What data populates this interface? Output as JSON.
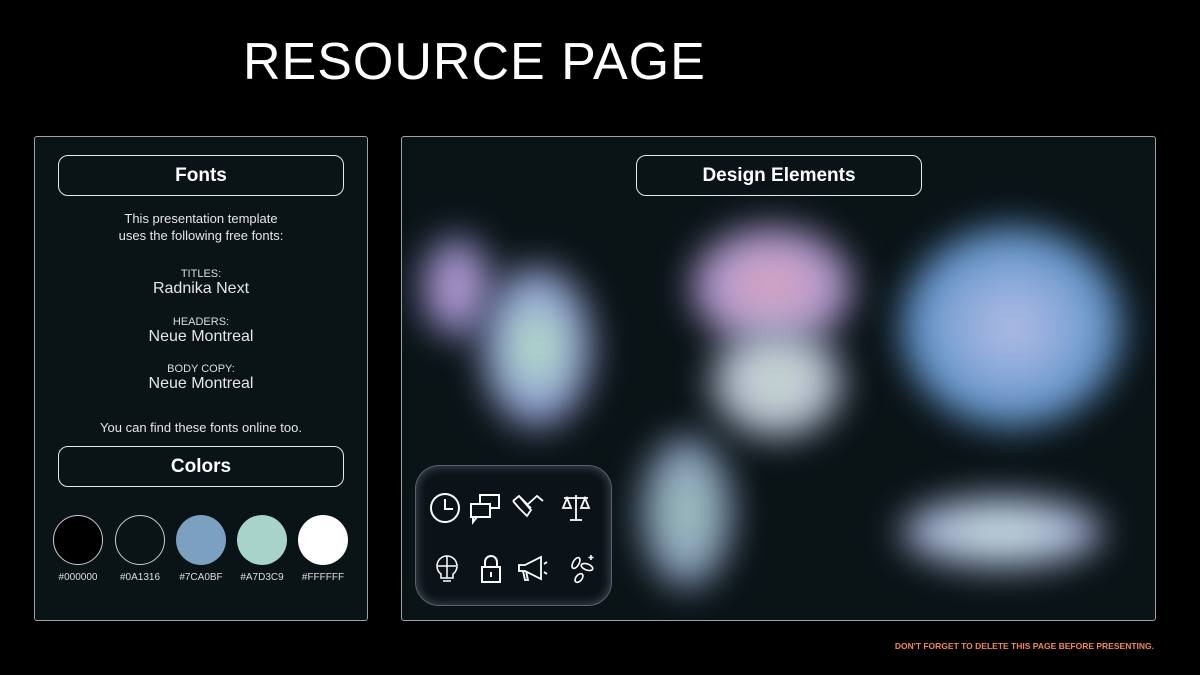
{
  "title": "RESOURCE PAGE",
  "fonts": {
    "heading": "Fonts",
    "intro_line1": "This presentation template",
    "intro_line2": "uses the following free fonts:",
    "items": [
      {
        "label": "TITLES:",
        "value": "Radnika Next"
      },
      {
        "label": "HEADERS:",
        "value": "Neue Montreal"
      },
      {
        "label": "BODY COPY:",
        "value": "Neue Montreal"
      }
    ],
    "footer": "You can find these fonts online too."
  },
  "colors": {
    "heading": "Colors",
    "swatches": [
      {
        "label": "#000000",
        "hex": "#000000"
      },
      {
        "label": "#0A1316",
        "hex": "#0A1316"
      },
      {
        "label": "#7CA0BF",
        "hex": "#7CA0BF"
      },
      {
        "label": "#A7D3C9",
        "hex": "#A7D3C9"
      },
      {
        "label": "#FFFFFF",
        "hex": "#FFFFFF"
      }
    ]
  },
  "design": {
    "heading": "Design Elements",
    "icons": [
      "clock-icon",
      "chat-bubbles-icon",
      "handshake-icon",
      "scales-icon",
      "lightbulb-puzzle-icon",
      "lock-icon",
      "megaphone-icon",
      "coins-icon"
    ]
  },
  "note": "DON'T FORGET TO DELETE THIS PAGE BEFORE PRESENTING.",
  "accent": "#F0875A"
}
